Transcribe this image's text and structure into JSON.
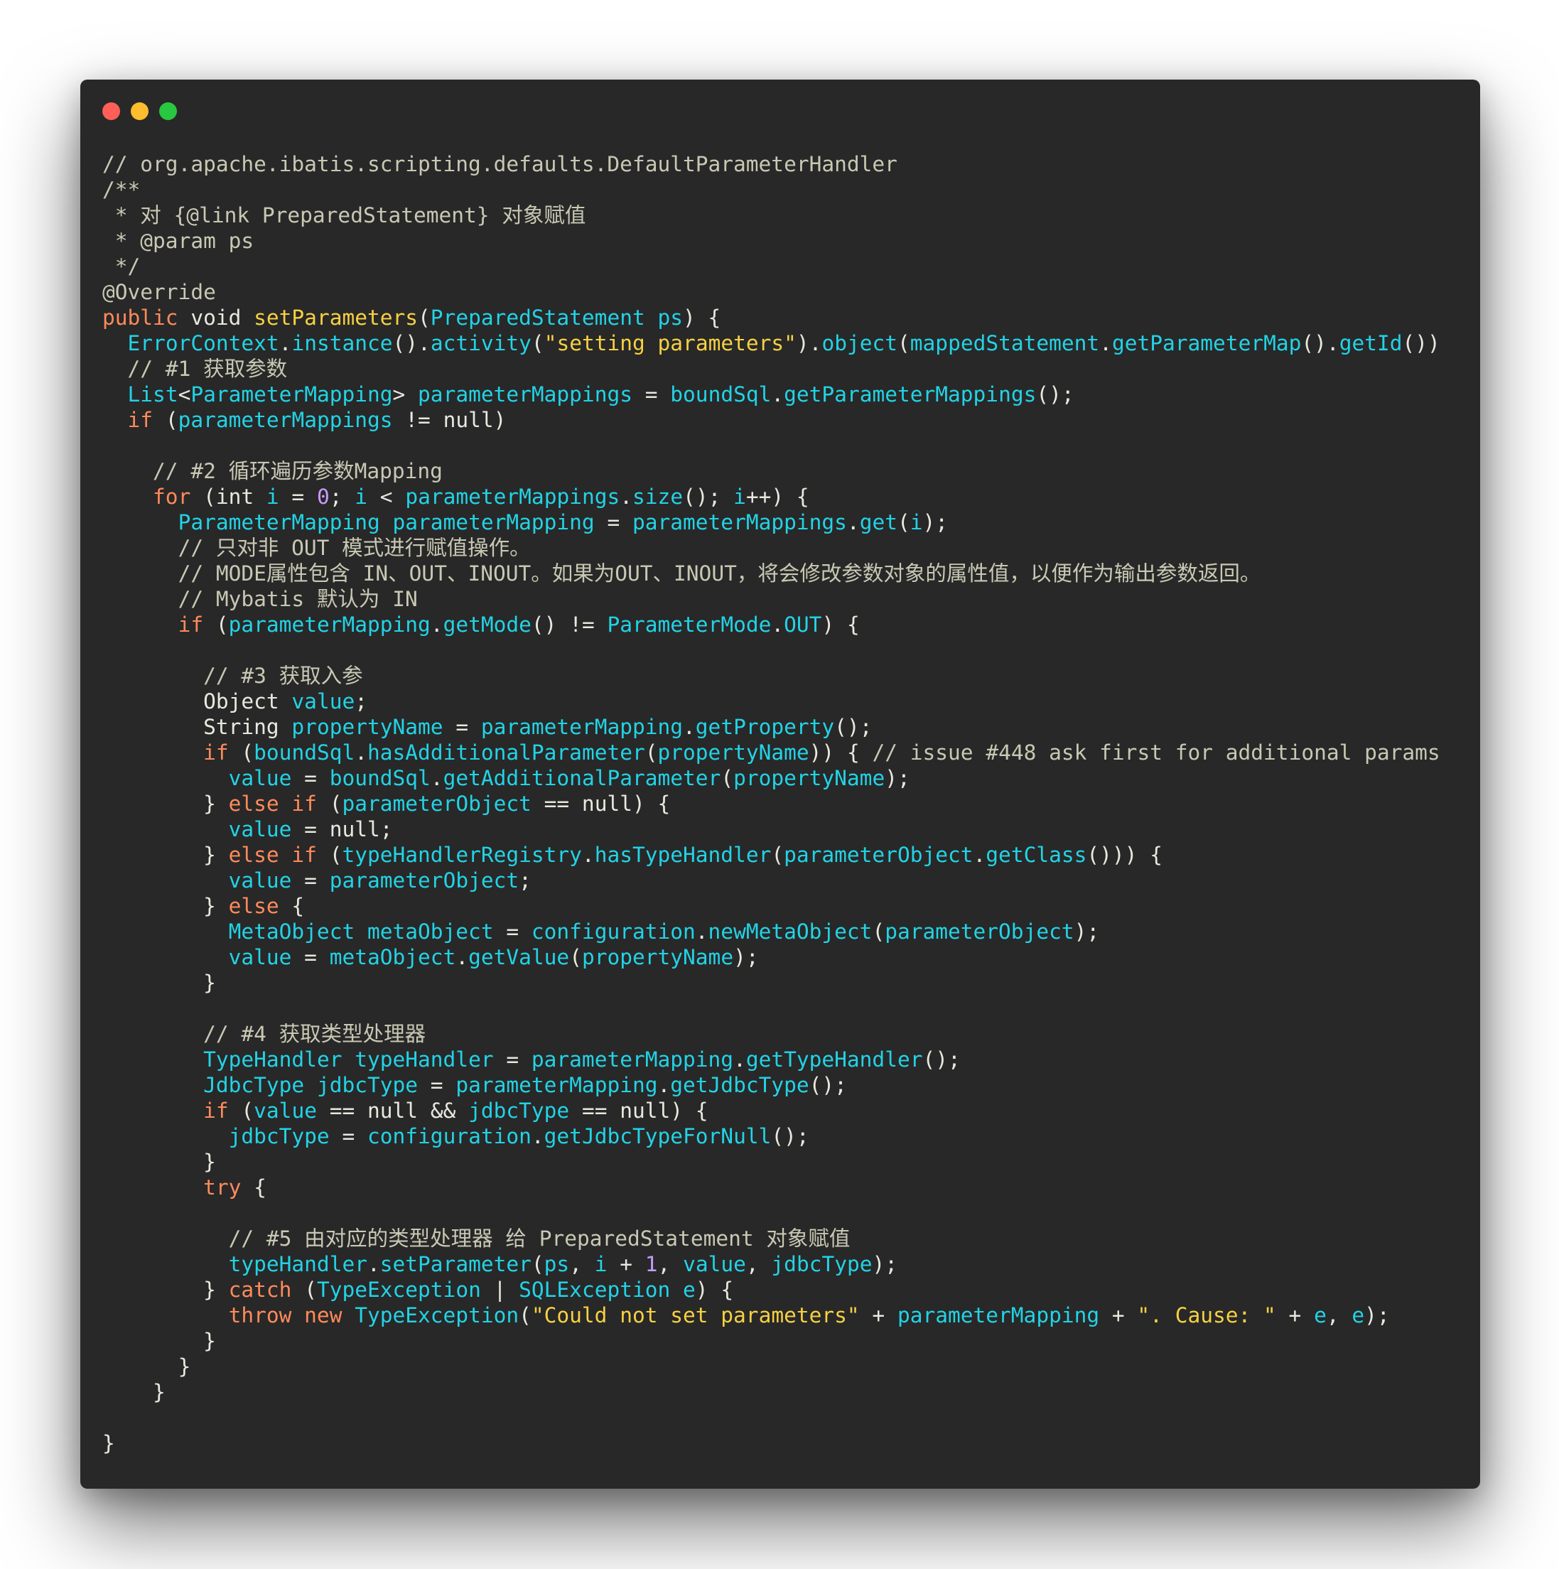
{
  "window": {
    "controls": {
      "close_color": "#ff5f57",
      "minimize_color": "#febc2e",
      "zoom_color": "#28c840"
    }
  },
  "colors": {
    "background": "#282828",
    "comment": "#c8c8b4",
    "keyword": "#ff8a5c",
    "function": "#f6d142",
    "string": "#f6d142",
    "identifier": "#22d3e6",
    "number": "#c79bff",
    "plain": "#e8e8df"
  },
  "code_lines": [
    [
      [
        "comment",
        "// org.apache.ibatis.scripting.defaults.DefaultParameterHandler"
      ]
    ],
    [
      [
        "comment",
        "/**"
      ]
    ],
    [
      [
        "comment",
        " * 对 {@link PreparedStatement} 对象赋值"
      ]
    ],
    [
      [
        "comment",
        " * @param ps"
      ]
    ],
    [
      [
        "comment",
        " */"
      ]
    ],
    [
      [
        "comment",
        "@Override"
      ]
    ],
    [
      [
        "kw",
        "public "
      ],
      [
        "plain",
        "void "
      ],
      [
        "fn",
        "setParameters"
      ],
      [
        "plain",
        "("
      ],
      [
        "id",
        "PreparedStatement ps"
      ],
      [
        "plain",
        ") {"
      ]
    ],
    [
      [
        "plain",
        "  "
      ],
      [
        "id",
        "ErrorContext"
      ],
      [
        "plain",
        "."
      ],
      [
        "id",
        "instance"
      ],
      [
        "plain",
        "()."
      ],
      [
        "id",
        "activity"
      ],
      [
        "plain",
        "("
      ],
      [
        "str",
        "\"setting parameters\""
      ],
      [
        "plain",
        ")."
      ],
      [
        "id",
        "object"
      ],
      [
        "plain",
        "("
      ],
      [
        "id",
        "mappedStatement"
      ],
      [
        "plain",
        "."
      ],
      [
        "id",
        "getParameterMap"
      ],
      [
        "plain",
        "()."
      ],
      [
        "id",
        "getId"
      ],
      [
        "plain",
        "())"
      ]
    ],
    [
      [
        "comment",
        "  // #1 获取参数"
      ]
    ],
    [
      [
        "plain",
        "  "
      ],
      [
        "id",
        "List"
      ],
      [
        "plain",
        "<"
      ],
      [
        "id",
        "ParameterMapping"
      ],
      [
        "plain",
        "> "
      ],
      [
        "id",
        "parameterMappings"
      ],
      [
        "plain",
        " = "
      ],
      [
        "id",
        "boundSql"
      ],
      [
        "plain",
        "."
      ],
      [
        "id",
        "getParameterMappings"
      ],
      [
        "plain",
        "();"
      ]
    ],
    [
      [
        "plain",
        "  "
      ],
      [
        "kw",
        "if "
      ],
      [
        "plain",
        "("
      ],
      [
        "id",
        "parameterMappings"
      ],
      [
        "plain",
        " != null)"
      ]
    ],
    [
      [
        "plain",
        ""
      ]
    ],
    [
      [
        "comment",
        "    // #2 循环遍历参数Mapping"
      ]
    ],
    [
      [
        "plain",
        "    "
      ],
      [
        "kw",
        "for "
      ],
      [
        "plain",
        "(int "
      ],
      [
        "id",
        "i"
      ],
      [
        "plain",
        " = "
      ],
      [
        "num",
        "0"
      ],
      [
        "plain",
        "; "
      ],
      [
        "id",
        "i"
      ],
      [
        "plain",
        " < "
      ],
      [
        "id",
        "parameterMappings"
      ],
      [
        "plain",
        "."
      ],
      [
        "id",
        "size"
      ],
      [
        "plain",
        "(); "
      ],
      [
        "id",
        "i"
      ],
      [
        "plain",
        "++) {"
      ]
    ],
    [
      [
        "plain",
        "      "
      ],
      [
        "id",
        "ParameterMapping parameterMapping"
      ],
      [
        "plain",
        " = "
      ],
      [
        "id",
        "parameterMappings"
      ],
      [
        "plain",
        "."
      ],
      [
        "id",
        "get"
      ],
      [
        "plain",
        "("
      ],
      [
        "id",
        "i"
      ],
      [
        "plain",
        ");"
      ]
    ],
    [
      [
        "comment",
        "      // 只对非 OUT 模式进行赋值操作。"
      ]
    ],
    [
      [
        "comment",
        "      // MODE属性包含 IN、OUT、INOUT。如果为OUT、INOUT，将会修改参数对象的属性值，以便作为输出参数返回。"
      ]
    ],
    [
      [
        "comment",
        "      // Mybatis 默认为 IN"
      ]
    ],
    [
      [
        "plain",
        "      "
      ],
      [
        "kw",
        "if "
      ],
      [
        "plain",
        "("
      ],
      [
        "id",
        "parameterMapping"
      ],
      [
        "plain",
        "."
      ],
      [
        "id",
        "getMode"
      ],
      [
        "plain",
        "() != "
      ],
      [
        "id",
        "ParameterMode"
      ],
      [
        "plain",
        "."
      ],
      [
        "id",
        "OUT"
      ],
      [
        "plain",
        ") {"
      ]
    ],
    [
      [
        "plain",
        ""
      ]
    ],
    [
      [
        "comment",
        "        // #3 获取入参"
      ]
    ],
    [
      [
        "plain",
        "        Object "
      ],
      [
        "id",
        "value"
      ],
      [
        "plain",
        ";"
      ]
    ],
    [
      [
        "plain",
        "        String "
      ],
      [
        "id",
        "propertyName"
      ],
      [
        "plain",
        " = "
      ],
      [
        "id",
        "parameterMapping"
      ],
      [
        "plain",
        "."
      ],
      [
        "id",
        "getProperty"
      ],
      [
        "plain",
        "();"
      ]
    ],
    [
      [
        "plain",
        "        "
      ],
      [
        "kw",
        "if "
      ],
      [
        "plain",
        "("
      ],
      [
        "id",
        "boundSql"
      ],
      [
        "plain",
        "."
      ],
      [
        "id",
        "hasAdditionalParameter"
      ],
      [
        "plain",
        "("
      ],
      [
        "id",
        "propertyName"
      ],
      [
        "plain",
        ")) { "
      ],
      [
        "comment",
        "// issue #448 ask first for additional params"
      ]
    ],
    [
      [
        "plain",
        "          "
      ],
      [
        "id",
        "value"
      ],
      [
        "plain",
        " = "
      ],
      [
        "id",
        "boundSql"
      ],
      [
        "plain",
        "."
      ],
      [
        "id",
        "getAdditionalParameter"
      ],
      [
        "plain",
        "("
      ],
      [
        "id",
        "propertyName"
      ],
      [
        "plain",
        ");"
      ]
    ],
    [
      [
        "plain",
        "        } "
      ],
      [
        "kw",
        "else if "
      ],
      [
        "plain",
        "("
      ],
      [
        "id",
        "parameterObject"
      ],
      [
        "plain",
        " == null) {"
      ]
    ],
    [
      [
        "plain",
        "          "
      ],
      [
        "id",
        "value"
      ],
      [
        "plain",
        " = null;"
      ]
    ],
    [
      [
        "plain",
        "        } "
      ],
      [
        "kw",
        "else if "
      ],
      [
        "plain",
        "("
      ],
      [
        "id",
        "typeHandlerRegistry"
      ],
      [
        "plain",
        "."
      ],
      [
        "id",
        "hasTypeHandler"
      ],
      [
        "plain",
        "("
      ],
      [
        "id",
        "parameterObject"
      ],
      [
        "plain",
        "."
      ],
      [
        "id",
        "getClass"
      ],
      [
        "plain",
        "())) {"
      ]
    ],
    [
      [
        "plain",
        "          "
      ],
      [
        "id",
        "value"
      ],
      [
        "plain",
        " = "
      ],
      [
        "id",
        "parameterObject"
      ],
      [
        "plain",
        ";"
      ]
    ],
    [
      [
        "plain",
        "        } "
      ],
      [
        "kw",
        "else "
      ],
      [
        "plain",
        "{"
      ]
    ],
    [
      [
        "plain",
        "          "
      ],
      [
        "id",
        "MetaObject metaObject"
      ],
      [
        "plain",
        " = "
      ],
      [
        "id",
        "configuration"
      ],
      [
        "plain",
        "."
      ],
      [
        "id",
        "newMetaObject"
      ],
      [
        "plain",
        "("
      ],
      [
        "id",
        "parameterObject"
      ],
      [
        "plain",
        ");"
      ]
    ],
    [
      [
        "plain",
        "          "
      ],
      [
        "id",
        "value"
      ],
      [
        "plain",
        " = "
      ],
      [
        "id",
        "metaObject"
      ],
      [
        "plain",
        "."
      ],
      [
        "id",
        "getValue"
      ],
      [
        "plain",
        "("
      ],
      [
        "id",
        "propertyName"
      ],
      [
        "plain",
        ");"
      ]
    ],
    [
      [
        "plain",
        "        }"
      ]
    ],
    [
      [
        "plain",
        ""
      ]
    ],
    [
      [
        "comment",
        "        // #4 获取类型处理器"
      ]
    ],
    [
      [
        "plain",
        "        "
      ],
      [
        "id",
        "TypeHandler typeHandler"
      ],
      [
        "plain",
        " = "
      ],
      [
        "id",
        "parameterMapping"
      ],
      [
        "plain",
        "."
      ],
      [
        "id",
        "getTypeHandler"
      ],
      [
        "plain",
        "();"
      ]
    ],
    [
      [
        "plain",
        "        "
      ],
      [
        "id",
        "JdbcType jdbcType"
      ],
      [
        "plain",
        " = "
      ],
      [
        "id",
        "parameterMapping"
      ],
      [
        "plain",
        "."
      ],
      [
        "id",
        "getJdbcType"
      ],
      [
        "plain",
        "();"
      ]
    ],
    [
      [
        "plain",
        "        "
      ],
      [
        "kw",
        "if "
      ],
      [
        "plain",
        "("
      ],
      [
        "id",
        "value"
      ],
      [
        "plain",
        " == null && "
      ],
      [
        "id",
        "jdbcType"
      ],
      [
        "plain",
        " == null) {"
      ]
    ],
    [
      [
        "plain",
        "          "
      ],
      [
        "id",
        "jdbcType"
      ],
      [
        "plain",
        " = "
      ],
      [
        "id",
        "configuration"
      ],
      [
        "plain",
        "."
      ],
      [
        "id",
        "getJdbcTypeForNull"
      ],
      [
        "plain",
        "();"
      ]
    ],
    [
      [
        "plain",
        "        }"
      ]
    ],
    [
      [
        "plain",
        "        "
      ],
      [
        "kw",
        "try "
      ],
      [
        "plain",
        "{"
      ]
    ],
    [
      [
        "plain",
        ""
      ]
    ],
    [
      [
        "comment",
        "          // #5 由对应的类型处理器 给 PreparedStatement 对象赋值"
      ]
    ],
    [
      [
        "plain",
        "          "
      ],
      [
        "id",
        "typeHandler"
      ],
      [
        "plain",
        "."
      ],
      [
        "id",
        "setParameter"
      ],
      [
        "plain",
        "("
      ],
      [
        "id",
        "ps"
      ],
      [
        "plain",
        ", "
      ],
      [
        "id",
        "i"
      ],
      [
        "plain",
        " + "
      ],
      [
        "num",
        "1"
      ],
      [
        "plain",
        ", "
      ],
      [
        "id",
        "value"
      ],
      [
        "plain",
        ", "
      ],
      [
        "id",
        "jdbcType"
      ],
      [
        "plain",
        ");"
      ]
    ],
    [
      [
        "plain",
        "        } "
      ],
      [
        "kw",
        "catch "
      ],
      [
        "plain",
        "("
      ],
      [
        "id",
        "TypeException"
      ],
      [
        "plain",
        " | "
      ],
      [
        "id",
        "SQLException e"
      ],
      [
        "plain",
        ") {"
      ]
    ],
    [
      [
        "plain",
        "          "
      ],
      [
        "kw",
        "throw new "
      ],
      [
        "id",
        "TypeException"
      ],
      [
        "plain",
        "("
      ],
      [
        "str",
        "\"Could not set parameters\""
      ],
      [
        "plain",
        " + "
      ],
      [
        "id",
        "parameterMapping"
      ],
      [
        "plain",
        " + "
      ],
      [
        "str",
        "\". Cause: \""
      ],
      [
        "plain",
        " + "
      ],
      [
        "id",
        "e"
      ],
      [
        "plain",
        ", "
      ],
      [
        "id",
        "e"
      ],
      [
        "plain",
        ");"
      ]
    ],
    [
      [
        "plain",
        "        }"
      ]
    ],
    [
      [
        "plain",
        "      }"
      ]
    ],
    [
      [
        "plain",
        "    }"
      ]
    ],
    [
      [
        "plain",
        ""
      ]
    ],
    [
      [
        "plain",
        "}"
      ]
    ]
  ]
}
